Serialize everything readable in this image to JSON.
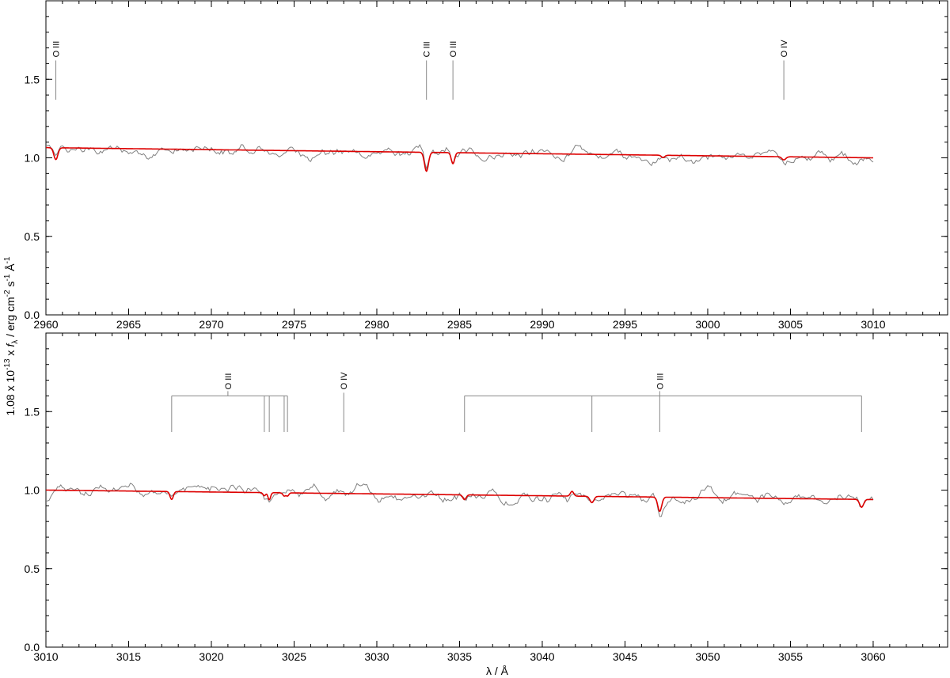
{
  "figure": {
    "xlabel": "λ / Å",
    "ylabel": "1.08 x 10-13 x fλ / erg cm-2 s-1 Å-1",
    "ylabel_parts": {
      "a": "1.08 x 10",
      "a_sup": "13",
      "b": " x ",
      "f": "f",
      "f_sub": "λ",
      "c": " / erg cm",
      "c_sup": "-2",
      "d": " s",
      "d_sup": "-1",
      "e": " Å",
      "e_sup": "-1"
    }
  },
  "chart_data": [
    {
      "type": "line",
      "panel": "top",
      "xlim": [
        2960,
        3014.5
      ],
      "ylim": [
        0,
        2.0
      ],
      "xticks": [
        2960,
        2965,
        2970,
        2975,
        2980,
        2985,
        2990,
        2995,
        3000,
        3005,
        3010
      ],
      "yticks": [
        0.0,
        0.5,
        1.0,
        1.5
      ],
      "ytick_labels": [
        "0.0",
        "0.5",
        "1.0",
        "1.5"
      ],
      "grid": false,
      "series": [
        {
          "role": "observed",
          "color": "#808080",
          "x_range": [
            2960,
            3010
          ],
          "continuum": [
            1.05,
            1.0
          ],
          "noise": 0.045
        },
        {
          "role": "model",
          "color": "#dd0000",
          "x_range": [
            2960,
            3010
          ],
          "continuum": [
            1.065,
            1.0
          ]
        }
      ],
      "absorption_lines": [
        {
          "x": 2960.6,
          "depth": 0.075,
          "width": 0.12
        },
        {
          "x": 2983.0,
          "depth": 0.12,
          "width": 0.12
        },
        {
          "x": 2984.6,
          "depth": 0.07,
          "width": 0.1
        },
        {
          "x": 2997.3,
          "depth": 0.015,
          "width": 0.1
        },
        {
          "x": 3004.6,
          "depth": 0.02,
          "width": 0.12
        }
      ],
      "line_ids": [
        {
          "label": "O III",
          "x": 2960.6,
          "y_top": 1.62,
          "y_bottom": 1.37
        },
        {
          "label": "C III",
          "x": 2983.0,
          "y_top": 1.62,
          "y_bottom": 1.37
        },
        {
          "label": "O III",
          "x": 2984.6,
          "y_top": 1.62,
          "y_bottom": 1.37
        },
        {
          "label": "O IV",
          "x": 3004.6,
          "y_top": 1.62,
          "y_bottom": 1.37
        }
      ],
      "multiplets": []
    },
    {
      "type": "line",
      "panel": "bottom",
      "xlim": [
        3010,
        3064.5
      ],
      "ylim": [
        0,
        2.0
      ],
      "xticks": [
        3010,
        3015,
        3020,
        3025,
        3030,
        3035,
        3040,
        3045,
        3050,
        3055,
        3060
      ],
      "yticks": [
        0.0,
        0.5,
        1.0,
        1.5
      ],
      "ytick_labels": [
        "0.0",
        "0.5",
        "1.0",
        "1.5"
      ],
      "grid": false,
      "series": [
        {
          "role": "observed",
          "color": "#808080",
          "x_range": [
            3010,
            3060
          ],
          "continuum": [
            1.0,
            0.94
          ],
          "noise": 0.05
        },
        {
          "role": "model",
          "color": "#dd0000",
          "x_range": [
            3010,
            3060
          ],
          "continuum": [
            1.0,
            0.94
          ]
        }
      ],
      "absorption_lines": [
        {
          "x": 3017.6,
          "depth": 0.05,
          "width": 0.1
        },
        {
          "x": 3023.2,
          "depth": 0.02,
          "width": 0.08
        },
        {
          "x": 3023.5,
          "depth": 0.045,
          "width": 0.08
        },
        {
          "x": 3024.4,
          "depth": 0.02,
          "width": 0.08
        },
        {
          "x": 3024.6,
          "depth": 0.02,
          "width": 0.08
        },
        {
          "x": 3035.3,
          "depth": 0.03,
          "width": 0.1
        },
        {
          "x": 3041.8,
          "depth": -0.03,
          "width": 0.1
        },
        {
          "x": 3043.0,
          "depth": 0.04,
          "width": 0.12
        },
        {
          "x": 3047.1,
          "depth": 0.09,
          "width": 0.12
        },
        {
          "x": 3059.3,
          "depth": 0.05,
          "width": 0.12
        }
      ],
      "line_ids": [
        {
          "label": "O IV",
          "x": 3028.0,
          "y_top": 1.62,
          "y_bottom": 1.37
        }
      ],
      "multiplets": [
        {
          "label": "O III",
          "label_x": 3021.0,
          "bar_y": 1.6,
          "y_bottom": 1.37,
          "components": [
            3017.6,
            3023.2,
            3023.5,
            3024.4,
            3024.6
          ]
        },
        {
          "label": "O III",
          "label_x": 3047.1,
          "bar_y": 1.6,
          "y_bottom": 1.37,
          "components": [
            3035.3,
            3043.0,
            3047.1,
            3059.3
          ]
        }
      ]
    }
  ]
}
